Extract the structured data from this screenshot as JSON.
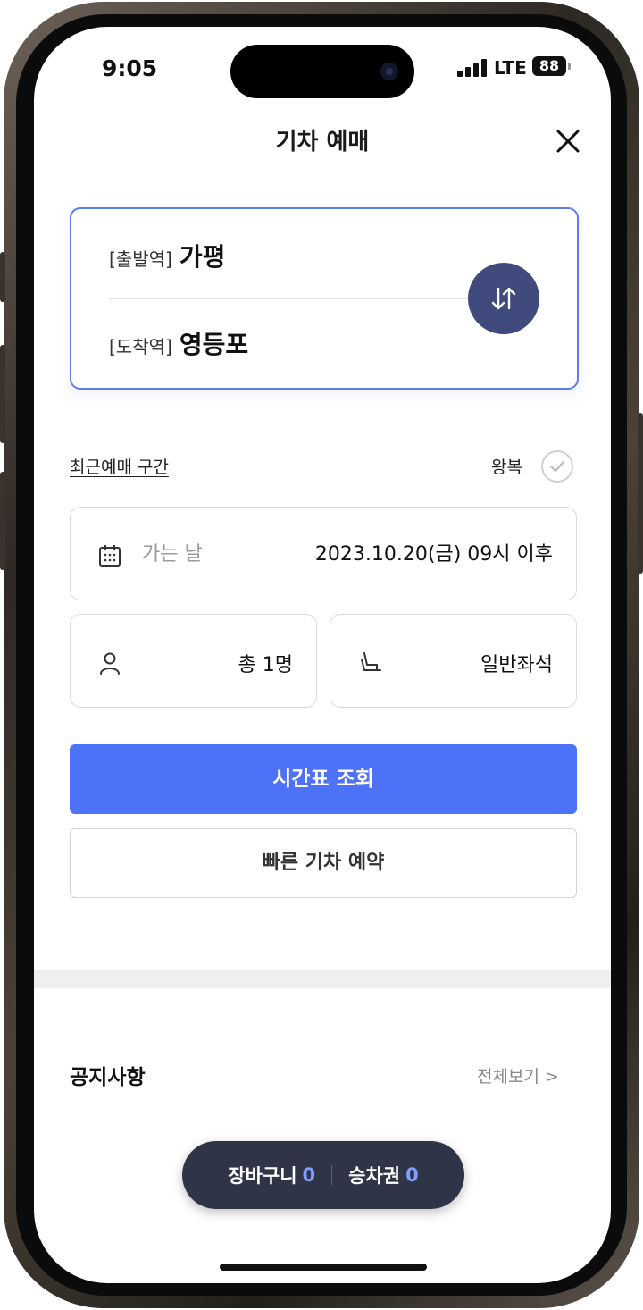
{
  "status_bar": {
    "time": "9:05",
    "network": "LTE",
    "battery": "88"
  },
  "header": {
    "title": "기차 예매"
  },
  "stations": {
    "departure_prefix": "[출발역]",
    "departure": "가평",
    "arrival_prefix": "[도착역]",
    "arrival": "영등포"
  },
  "options": {
    "recent_link": "최근예매 구간",
    "roundtrip_label": "왕복"
  },
  "date_field": {
    "label": "가는 날",
    "value": "2023.10.20(금) 09시 이후"
  },
  "passenger_field": {
    "value": "총 1명"
  },
  "seat_field": {
    "value": "일반좌석"
  },
  "buttons": {
    "search": "시간표 조회",
    "quick_reserve": "빠른 기차 예약"
  },
  "notice": {
    "title": "공지사항",
    "view_all": "전체보기 >"
  },
  "bottom_pill": {
    "cart_label": "장바구니",
    "cart_count": "0",
    "ticket_label": "승차권",
    "ticket_count": "0"
  },
  "colors": {
    "primary": "#4e72f7",
    "swap": "#414a7c",
    "pill": "#2f3547",
    "count": "#7f9cff"
  }
}
